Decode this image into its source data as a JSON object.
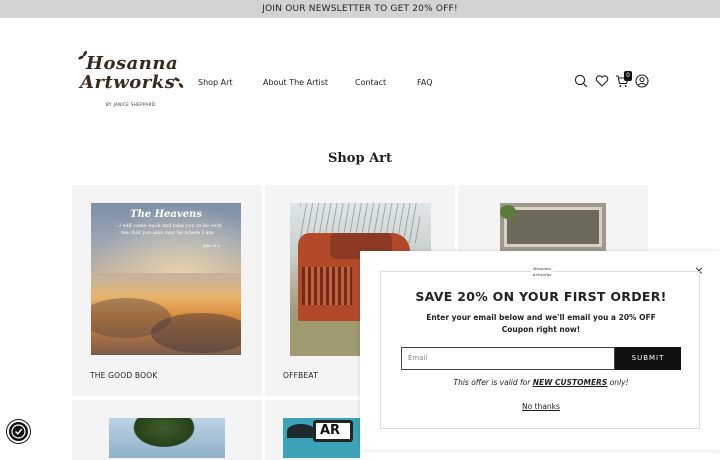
{
  "announcement": "JOIN OUR NEWSLETTER TO GET 20% OFF!",
  "logo": {
    "line1": "Hosanna",
    "line2": "Artworks",
    "sub": "BY JANICE SHEPPARD"
  },
  "nav": [
    "Shop Art",
    "About The Artist",
    "Contact",
    "FAQ"
  ],
  "header_icons": [
    "search-icon",
    "heart-icon",
    "cart-icon",
    "account-icon"
  ],
  "cart_count": "0",
  "page_title": "Shop Art",
  "products": [
    {
      "label": "THE GOOD BOOK",
      "art_title": "The Heavens",
      "art_text": "...I will come back and take you to be with me that you also may be where I am.",
      "art_ref": "John 14:3"
    },
    {
      "label": "OFFBEAT"
    },
    {
      "label": ""
    },
    {
      "label": ""
    },
    {
      "label": "",
      "art_text": "AR"
    }
  ],
  "popup": {
    "logo": "Hosanna Artworks",
    "title": "SAVE 20% ON YOUR FIRST ORDER!",
    "description": "Enter your email below and we'll email you a 20% OFF Coupon right now!",
    "email_placeholder": "Email",
    "submit_label": "SUBMIT",
    "note_prefix": "This offer is valid for ",
    "note_bold": "NEW CUSTOMERS",
    "note_suffix": " only!",
    "no_thanks": "No thanks",
    "close": "×"
  },
  "colors": {
    "brand_brown": "#3a2a1e",
    "announcement_bg": "#d3d3d3",
    "card_bg": "#f4f4f4",
    "button_bg": "#111111"
  }
}
